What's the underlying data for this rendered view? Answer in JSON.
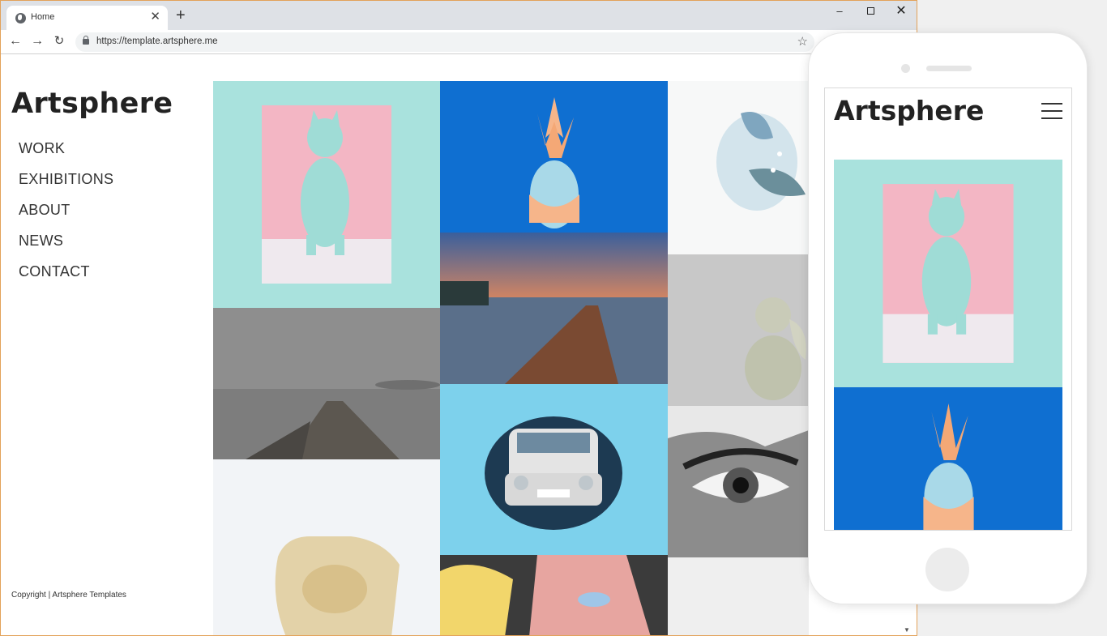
{
  "browser": {
    "tab_title": "Home",
    "tab_close": "✕",
    "new_tab": "+",
    "url": "https://template.artsphere.me",
    "window_controls": {
      "minimize": "–",
      "close": "✕"
    },
    "nav": {
      "back": "←",
      "forward": "→",
      "reload": "↻",
      "bookmark": "☆"
    }
  },
  "site": {
    "logo": "Artsphere",
    "nav": [
      "WORK",
      "EXHIBITIONS",
      "ABOUT",
      "NEWS",
      "CONTACT"
    ],
    "copyright": "Copyright | Artsphere Templates"
  },
  "gallery": [
    "cat-figurine-artwork",
    "pineapple-artwork",
    "flowers-watercolor-artwork",
    "jetty-sunset-photo",
    "foggy-pier-photo",
    "angel-statue-photo",
    "trabant-wall-mural",
    "eye-drawing-artwork",
    "torso-sculpture-photo",
    "pop-art-face-mural"
  ],
  "mobile": {
    "logo": "Artsphere",
    "menu_icon": "hamburger-icon"
  },
  "colors": {
    "teal": "#a9e2dd",
    "pink": "#f3b6c4",
    "blue": "#0f6fd1",
    "peach": "#f6b58a"
  }
}
